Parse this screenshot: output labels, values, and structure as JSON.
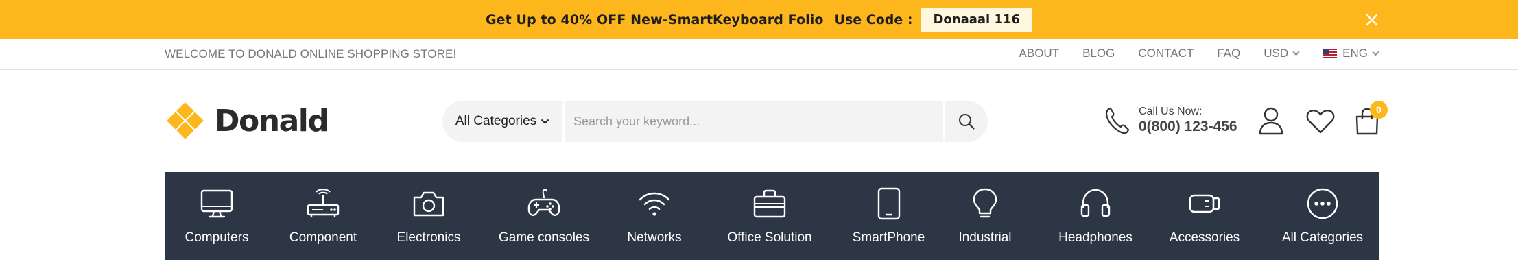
{
  "promo": {
    "text": "Get Up to 40% OFF New-SmartKeyboard Folio",
    "code_label": "Use Code :",
    "code": "Donaaal 116",
    "background": "#fdb71c"
  },
  "topbar": {
    "welcome": "WELCOME TO DONALD ONLINE SHOPPING STORE!",
    "links": {
      "about": "ABOUT",
      "blog": "BLOG",
      "contact": "CONTACT",
      "faq": "FAQ"
    },
    "currency": "USD",
    "language": "ENG"
  },
  "header": {
    "logo_text": "Donald",
    "logo_color": "#fdb71c",
    "search": {
      "category": "All Categories",
      "placeholder": "Search your keyword..."
    },
    "call_label": "Call Us Now:",
    "phone": "0(800) 123-456",
    "cart_count": "0"
  },
  "categories": [
    {
      "label": "Computers",
      "icon": "monitor-icon"
    },
    {
      "label": "Component",
      "icon": "router-icon"
    },
    {
      "label": "Electronics",
      "icon": "camera-icon"
    },
    {
      "label": "Game consoles",
      "icon": "gamepad-icon"
    },
    {
      "label": "Networks",
      "icon": "wifi-icon"
    },
    {
      "label": "Office Solution",
      "icon": "briefcase-icon"
    },
    {
      "label": "SmartPhone",
      "icon": "smartphone-icon"
    },
    {
      "label": "Industrial",
      "icon": "lightbulb-icon"
    },
    {
      "label": "Headphones",
      "icon": "headphones-icon"
    },
    {
      "label": "Accessories",
      "icon": "accessory-icon"
    },
    {
      "label": "All Categories",
      "icon": "more-icon"
    }
  ],
  "colors": {
    "accent": "#fdb71c",
    "nav_background": "#2d3644"
  }
}
